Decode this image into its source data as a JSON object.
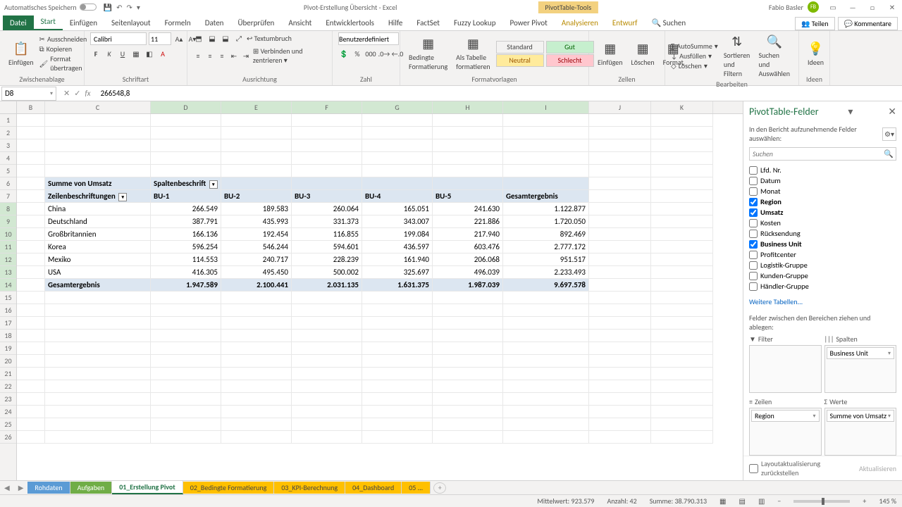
{
  "title": {
    "auto_save": "Automatisches Speichern",
    "doc": "Pivot-Erstellung Übersicht - Excel",
    "tools": "PivotTable-Tools",
    "user": "Fabio Basler",
    "initials": "FB"
  },
  "tabs": {
    "file": "Datei",
    "start": "Start",
    "einfugen": "Einfügen",
    "layout": "Seitenlayout",
    "formeln": "Formeln",
    "daten": "Daten",
    "pruf": "Überprüfen",
    "ansicht": "Ansicht",
    "dev": "Entwicklertools",
    "hilfe": "Hilfe",
    "factset": "FactSet",
    "fuzzy": "Fuzzy Lookup",
    "power": "Power Pivot",
    "analyse": "Analysieren",
    "entwurf": "Entwurf",
    "suchen": "Suchen",
    "teilen": "Teilen",
    "kommentare": "Kommentare"
  },
  "ribbon": {
    "paste": "Einfügen",
    "cut": "Ausschneiden",
    "copy": "Kopieren",
    "fmtpaint": "Format übertragen",
    "clip": "Zwischenablage",
    "font_name": "Calibri",
    "font_size": "11",
    "schrift": "Schriftart",
    "wrap": "Textumbruch",
    "merge": "Verbinden und zentrieren",
    "ausrichtung": "Ausrichtung",
    "numfmt": "Benutzerdefiniert",
    "zahl": "Zahl",
    "bed": "Bedingte Formatierung",
    "als": "Als Tabelle formatieren",
    "std": "Standard",
    "gut": "Gut",
    "neutral": "Neutral",
    "schlecht": "Schlecht",
    "formatv": "Formatvorlagen",
    "ins": "Einfügen",
    "del": "Löschen",
    "fmt": "Format",
    "zellen": "Zellen",
    "autosum": "AutoSumme",
    "fill": "Ausfüllen",
    "clear": "Löschen",
    "sort": "Sortieren und Filtern",
    "find": "Suchen und Auswählen",
    "bearb": "Bearbeiten",
    "ideen": "Ideen"
  },
  "fbar": {
    "ref": "D8",
    "val": "266548,8"
  },
  "cols": [
    "B",
    "C",
    "D",
    "E",
    "F",
    "G",
    "H",
    "I",
    "J",
    "K"
  ],
  "pivot": {
    "measure": "Summe von Umsatz",
    "collabel": "Spaltenbeschrift",
    "rowlabel": "Zeilenbeschriftungen",
    "bu": [
      "BU-1",
      "BU-2",
      "BU-3",
      "BU-4",
      "BU-5"
    ],
    "grand": "Gesamtergebnis",
    "rows": [
      {
        "n": "China",
        "v": [
          "266.549",
          "189.583",
          "260.064",
          "165.051",
          "241.630",
          "1.122.877"
        ]
      },
      {
        "n": "Deutschland",
        "v": [
          "387.791",
          "435.993",
          "331.373",
          "343.007",
          "221.886",
          "1.720.050"
        ]
      },
      {
        "n": "Großbritannien",
        "v": [
          "166.136",
          "192.454",
          "116.855",
          "199.084",
          "217.940",
          "892.469"
        ]
      },
      {
        "n": "Korea",
        "v": [
          "596.254",
          "546.244",
          "594.601",
          "436.597",
          "603.476",
          "2.777.172"
        ]
      },
      {
        "n": "Mexiko",
        "v": [
          "114.553",
          "240.717",
          "228.239",
          "161.940",
          "206.068",
          "951.517"
        ]
      },
      {
        "n": "USA",
        "v": [
          "416.305",
          "495.450",
          "500.002",
          "325.697",
          "496.039",
          "2.233.493"
        ]
      }
    ],
    "totals": [
      "1.947.589",
      "2.100.441",
      "2.031.135",
      "1.631.375",
      "1.987.039",
      "9.697.578"
    ]
  },
  "pane": {
    "title": "PivotTable-Felder",
    "sub": "In den Bericht aufzunehmende Felder auswählen:",
    "search_ph": "Suchen",
    "fields": [
      {
        "n": "Lfd. Nr.",
        "c": false
      },
      {
        "n": "Datum",
        "c": false
      },
      {
        "n": "Monat",
        "c": false
      },
      {
        "n": "Region",
        "c": true
      },
      {
        "n": "Umsatz",
        "c": true
      },
      {
        "n": "Kosten",
        "c": false
      },
      {
        "n": "Rücksendung",
        "c": false
      },
      {
        "n": "Business Unit",
        "c": true
      },
      {
        "n": "Profitcenter",
        "c": false
      },
      {
        "n": "Logistik-Gruppe",
        "c": false
      },
      {
        "n": "Kunden-Gruppe",
        "c": false
      },
      {
        "n": "Händler-Gruppe",
        "c": false
      }
    ],
    "more": "Weitere Tabellen...",
    "areas_lbl": "Felder zwischen den Bereichen ziehen und ablegen:",
    "filter": "Filter",
    "spalten": "Spalten",
    "zeilen": "Zeilen",
    "werte": "Werte",
    "col_item": "Business Unit",
    "row_item": "Region",
    "val_item": "Summe von Umsatz",
    "defer": "Layoutaktualisierung zurückstellen",
    "update": "Aktualisieren"
  },
  "sheets": {
    "rohdaten": "Rohdaten",
    "aufgaben": "Aufgaben",
    "s1": "01_Erstellung Pivot",
    "s2": "02_Bedingte Formatierung",
    "s3": "03_KPI-Berechnung",
    "s4": "04_Dashboard",
    "s5": "05 ..."
  },
  "status": {
    "avg_l": "Mittelwert:",
    "avg": "923.579",
    "cnt_l": "Anzahl:",
    "cnt": "42",
    "sum_l": "Summe:",
    "sum": "38.790.313",
    "zoom": "145 %"
  }
}
